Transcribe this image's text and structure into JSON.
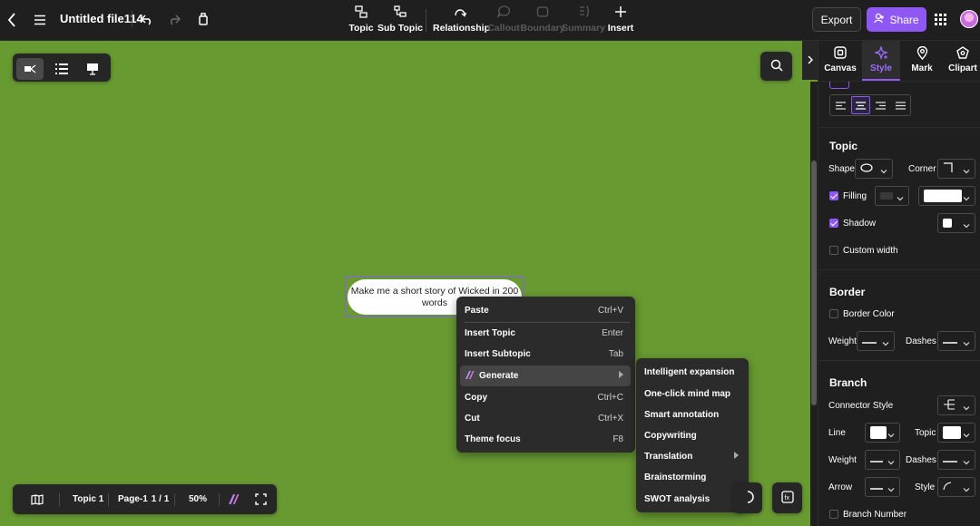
{
  "topbar": {
    "title": "Untitled file114",
    "tools": [
      {
        "label": "Topic",
        "icon": "topic-icon",
        "enabled": true
      },
      {
        "label": "Sub Topic",
        "icon": "subtopic-icon",
        "enabled": true
      },
      {
        "label": "Relationship",
        "icon": "relationship-icon",
        "enabled": true
      },
      {
        "label": "Callout",
        "icon": "callout-icon",
        "enabled": false
      },
      {
        "label": "Boundary",
        "icon": "boundary-icon",
        "enabled": false
      },
      {
        "label": "Summary",
        "icon": "summary-icon",
        "enabled": false
      },
      {
        "label": "Insert",
        "icon": "plus-icon",
        "enabled": true
      }
    ],
    "export_label": "Export",
    "share_label": "Share",
    "accent": "#8f58f5"
  },
  "canvas": {
    "background": "#689a32",
    "node_text": "Make me a short story of Wicked in 200 words"
  },
  "context_menu": {
    "items": [
      {
        "label": "Paste",
        "shortcut": "Ctrl+V"
      },
      {
        "label": "Insert Topic",
        "shortcut": "Enter"
      },
      {
        "label": "Insert Subtopic",
        "shortcut": "Tab"
      },
      {
        "label": "Generate",
        "shortcut": ""
      },
      {
        "label": "Copy",
        "shortcut": "Ctrl+C"
      },
      {
        "label": "Cut",
        "shortcut": "Ctrl+X"
      },
      {
        "label": "Theme focus",
        "shortcut": "F8"
      }
    ]
  },
  "submenu": {
    "items": [
      "Intelligent expansion",
      "One-click mind map",
      "Smart annotation",
      "Copywriting",
      "Translation",
      "Brainstorming",
      "SWOT analysis"
    ]
  },
  "bottom_bar": {
    "topic": "Topic 1",
    "page_label": "Page-1",
    "page_count": "1 / 1",
    "zoom": "50%"
  },
  "panel": {
    "tabs": [
      "Canvas",
      "Style",
      "Mark",
      "Clipart"
    ],
    "active_tab": "Style",
    "topic": {
      "title": "Topic",
      "shape_label": "Shape",
      "corner_label": "Corner",
      "filling_label": "Filling",
      "shadow_label": "Shadow",
      "custom_width_label": "Custom width"
    },
    "border": {
      "title": "Border",
      "color_label": "Border Color",
      "weight_label": "Weight",
      "dashes_label": "Dashes"
    },
    "branch": {
      "title": "Branch",
      "connector_label": "Connector Style",
      "line_label": "Line",
      "topic_label": "Topic",
      "weight_label": "Weight",
      "dashes_label": "Dashes",
      "arrow_label": "Arrow",
      "style_label": "Style",
      "branch_number_label": "Branch Number"
    }
  }
}
